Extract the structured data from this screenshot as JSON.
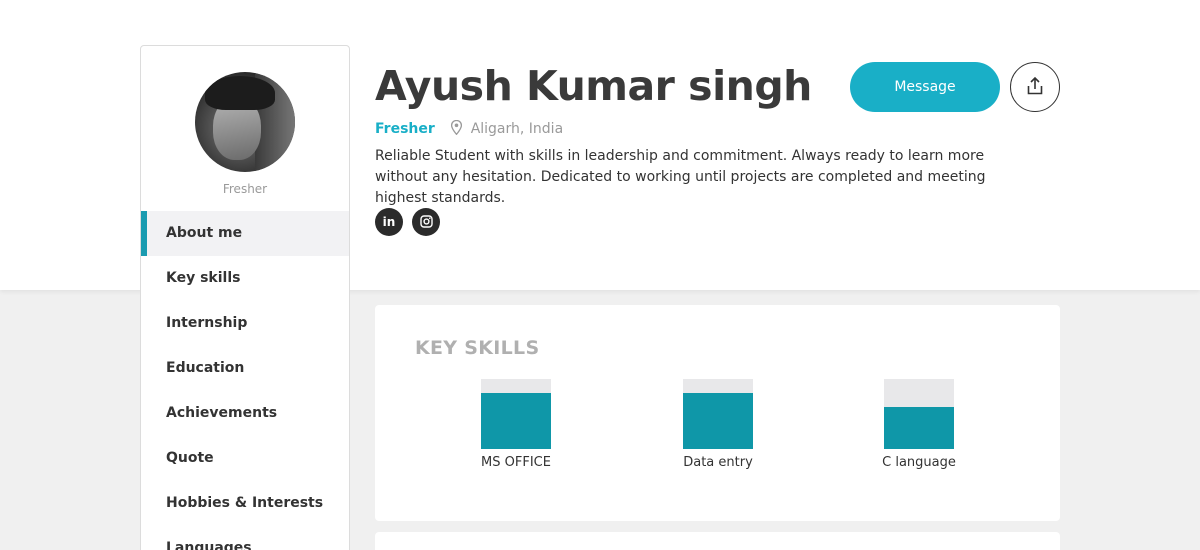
{
  "profile": {
    "name": "Ayush Kumar singh",
    "role": "Fresher",
    "location": "Aligarh, India",
    "bio": "Reliable Student with skills in leadership and commitment. Always ready to learn more without any hesitation. Dedicated to working until projects are completed and meeting highest standards.",
    "avatar_caption": "Fresher"
  },
  "actions": {
    "message_label": "Message",
    "share_icon": "share-upload-icon"
  },
  "social": {
    "linkedin_label": "in",
    "instagram_icon": "instagram-icon"
  },
  "sidebar": {
    "items": [
      {
        "label": "About me",
        "active": true
      },
      {
        "label": "Key skills"
      },
      {
        "label": "Internship"
      },
      {
        "label": "Education"
      },
      {
        "label": "Achievements"
      },
      {
        "label": "Quote"
      },
      {
        "label": "Hobbies & Interests"
      },
      {
        "label": "Languages"
      }
    ]
  },
  "key_skills": {
    "title": "KEY SKILLS",
    "skills": [
      {
        "name": "MS OFFICE",
        "level": 0.8
      },
      {
        "name": "Data entry",
        "level": 0.8
      },
      {
        "name": "C language",
        "level": 0.6
      }
    ]
  },
  "colors": {
    "accent": "#19afc7",
    "skill_fill": "#0f97a8",
    "text": "#333333"
  }
}
